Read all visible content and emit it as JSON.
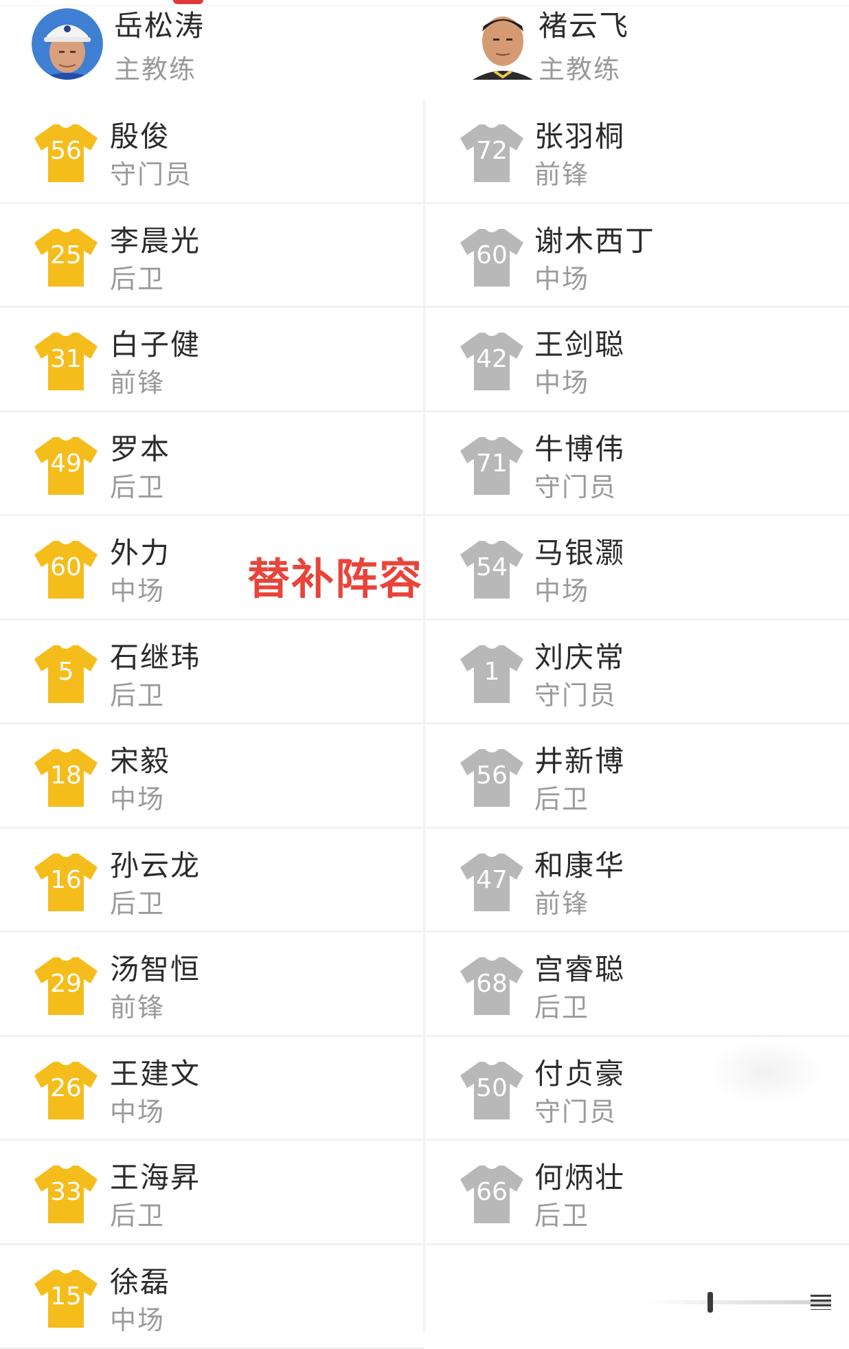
{
  "coaches": {
    "left": {
      "name": "岳松涛",
      "role": "主教练"
    },
    "right": {
      "name": "褚云飞",
      "role": "主教练"
    }
  },
  "overlay_label": "替补阵容",
  "colors": {
    "home_shirt": "#f5bd1c",
    "away_shirt": "#b8b8b8",
    "overlay_text": "#e8443a",
    "name_text": "#2b2b2b",
    "position_text": "#9a9a9a"
  },
  "home_players": [
    {
      "number": "56",
      "name": "殷俊",
      "position": "守门员"
    },
    {
      "number": "25",
      "name": "李晨光",
      "position": "后卫"
    },
    {
      "number": "31",
      "name": "白子健",
      "position": "前锋"
    },
    {
      "number": "49",
      "name": "罗本",
      "position": "后卫"
    },
    {
      "number": "60",
      "name": "外力",
      "position": "中场"
    },
    {
      "number": "5",
      "name": "石继玮",
      "position": "后卫"
    },
    {
      "number": "18",
      "name": "宋毅",
      "position": "中场"
    },
    {
      "number": "16",
      "name": "孙云龙",
      "position": "后卫"
    },
    {
      "number": "29",
      "name": "汤智恒",
      "position": "前锋"
    },
    {
      "number": "26",
      "name": "王建文",
      "position": "中场"
    },
    {
      "number": "33",
      "name": "王海昇",
      "position": "后卫"
    },
    {
      "number": "15",
      "name": "徐磊",
      "position": "中场"
    }
  ],
  "away_players": [
    {
      "number": "72",
      "name": "张羽桐",
      "position": "前锋"
    },
    {
      "number": "60",
      "name": "谢木西丁",
      "position": "中场"
    },
    {
      "number": "42",
      "name": "王剑聪",
      "position": "中场"
    },
    {
      "number": "71",
      "name": "牛博伟",
      "position": "守门员"
    },
    {
      "number": "54",
      "name": "马银灏",
      "position": "中场"
    },
    {
      "number": "1",
      "name": "刘庆常",
      "position": "守门员"
    },
    {
      "number": "56",
      "name": "井新博",
      "position": "后卫"
    },
    {
      "number": "47",
      "name": "和康华",
      "position": "前锋"
    },
    {
      "number": "68",
      "name": "宫睿聪",
      "position": "后卫"
    },
    {
      "number": "50",
      "name": "付贞豪",
      "position": "守门员"
    },
    {
      "number": "66",
      "name": "何炳壮",
      "position": "后卫"
    }
  ]
}
